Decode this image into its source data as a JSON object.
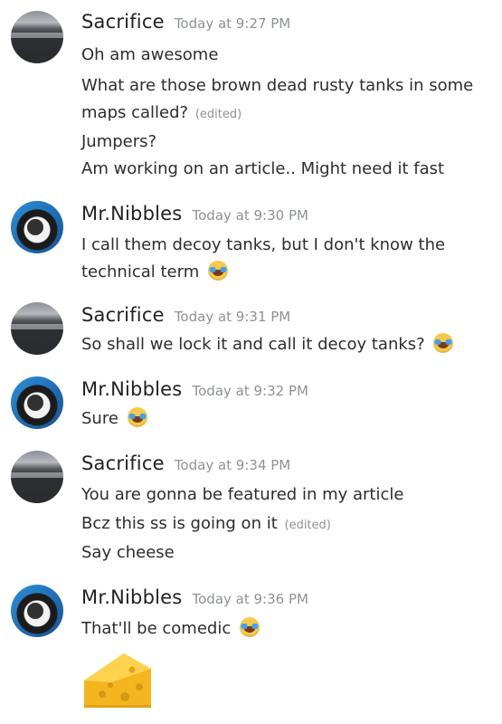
{
  "messages": [
    {
      "user": "Sacrifice",
      "time": "Today at 9:27 PM",
      "lines": [
        {
          "text": "Oh am awesome"
        },
        {
          "text": "What are those brown dead rusty tanks in some"
        },
        {
          "text": "maps called?",
          "edited": "(edited)"
        },
        {
          "text": "Jumpers?"
        },
        {
          "text": "Am working on an article.. Might need it fast"
        }
      ]
    },
    {
      "user": "Mr.Nibbles",
      "time": "Today at 9:30 PM",
      "lines": [
        {
          "text": "I call them decoy tanks, but I don't know the"
        },
        {
          "text": "technical term",
          "emoji": "joy"
        }
      ]
    },
    {
      "user": "Sacrifice",
      "time": "Today at 9:31 PM",
      "lines": [
        {
          "text": "So shall we lock it and call it decoy tanks?",
          "emoji": "joy"
        }
      ]
    },
    {
      "user": "Mr.Nibbles",
      "time": "Today at 9:32 PM",
      "lines": [
        {
          "text": "Sure",
          "emoji": "joy"
        }
      ]
    },
    {
      "user": "Sacrifice",
      "time": "Today at 9:34 PM",
      "lines": [
        {
          "text": "You are gonna be featured in my article"
        },
        {
          "text": "Bcz this ss is going on it",
          "edited": "(edited)"
        },
        {
          "text": "Say cheese"
        }
      ]
    },
    {
      "user": "Mr.Nibbles",
      "time": "Today at 9:36 PM",
      "lines": [
        {
          "text": "That'll be comedic",
          "emoji": "joy"
        }
      ]
    }
  ],
  "attachments": {
    "cheese_emoji": "cheese-emoji"
  }
}
